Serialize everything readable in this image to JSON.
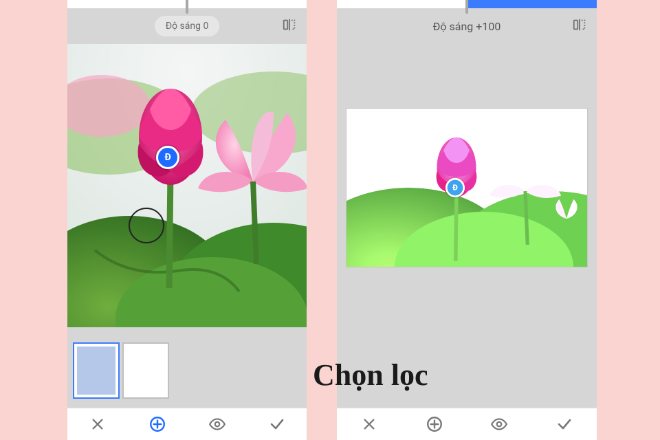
{
  "caption": "Chọn lọc",
  "marker_label": "Đ",
  "panels": {
    "left": {
      "brightness_label": "Độ sáng 0",
      "slider_fill_pct": 0,
      "toolbar": {
        "cancel": "×",
        "add": "+",
        "view": "eye",
        "confirm": "✓"
      },
      "marker": {
        "x_pct": 42,
        "y_pct": 40
      },
      "circle_marker": {
        "x_pct": 33,
        "y_pct": 64
      }
    },
    "right": {
      "brightness_label": "Độ sáng +100",
      "slider_fill_pct": 100,
      "toolbar": {
        "cancel": "×",
        "add": "+",
        "view": "eye",
        "confirm": "✓"
      },
      "marker": {
        "x_pct": 45,
        "y_pct": 50
      }
    }
  },
  "icons": {
    "compare": "compare-icon",
    "cancel": "close-icon",
    "add": "add-circle-icon",
    "view": "eye-icon",
    "confirm": "check-icon"
  }
}
